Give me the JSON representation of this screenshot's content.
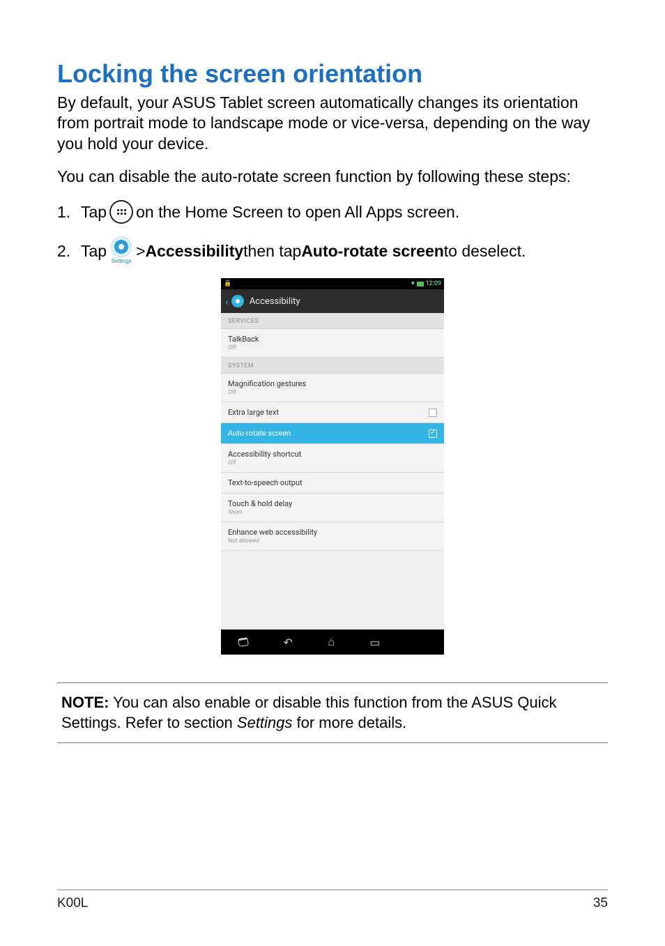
{
  "title": "Locking the screen orientation",
  "para1": "By default, your ASUS Tablet screen automatically changes its orientation from portrait mode to landscape mode or vice-versa, depending on the way you hold your device.",
  "para2": "You can disable the auto-rotate screen function by following these steps:",
  "step1": {
    "num": "1.",
    "a": "Tap ",
    "b": " on the Home Screen to open All Apps screen."
  },
  "step2": {
    "num": "2.",
    "a": "Tap ",
    "settings_label": "Settings",
    "b": " > ",
    "accessibility": "Accessibility",
    "c": " then tap ",
    "autorotate": "Auto-rotate screen",
    "d": " to deselect."
  },
  "shot": {
    "status_time": "12:09",
    "header": "Accessibility",
    "sections": {
      "services": "SERVICES",
      "system": "SYSTEM"
    },
    "rows": {
      "talkback": {
        "t1": "TalkBack",
        "t2": "Off"
      },
      "mag": {
        "t1": "Magnification gestures",
        "t2": "Off"
      },
      "large": {
        "t1": "Extra large text"
      },
      "auto": {
        "t1": "Auto-rotate screen"
      },
      "shortcut": {
        "t1": "Accessibility shortcut",
        "t2": "Off"
      },
      "tts": {
        "t1": "Text-to-speech output"
      },
      "touch": {
        "t1": "Touch & hold delay",
        "t2": "Short"
      },
      "web": {
        "t1": "Enhance web accessibility",
        "t2": "Not allowed"
      }
    }
  },
  "note": {
    "label": "NOTE:",
    "a": "  You can also enable or disable this function from the ASUS Quick Settings. Refer to section ",
    "i": "Settings",
    "b": " for more details."
  },
  "footer": {
    "model": "K00L",
    "page": "35"
  }
}
